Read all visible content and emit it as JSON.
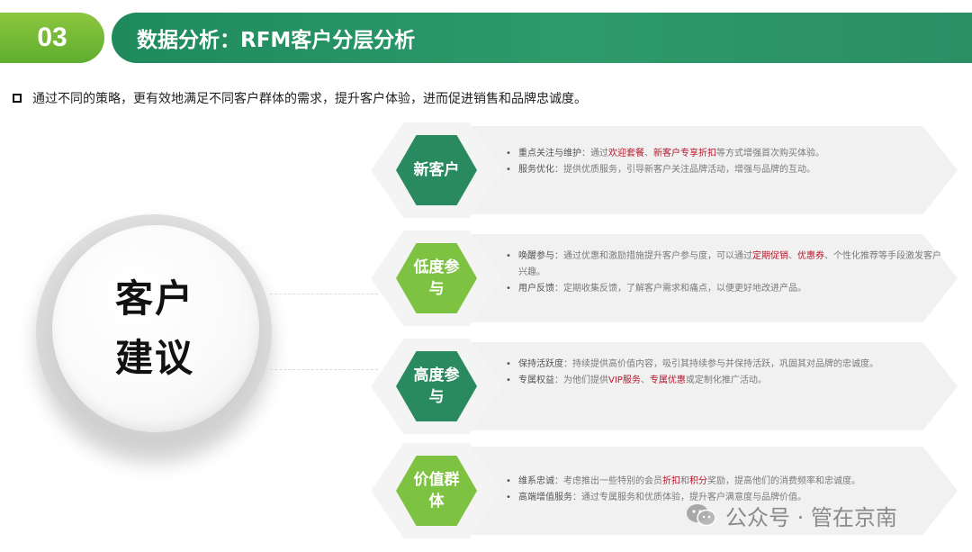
{
  "header": {
    "number": "03",
    "title": "数据分析：RFM客户分层分析"
  },
  "intro": "通过不同的策略，更有效地满足不同客户群体的需求，提升客户体验，进而促进销售和品牌忠诚度。",
  "center": {
    "line1": "客户",
    "line2": "建议"
  },
  "rows": [
    {
      "badge": "新客户",
      "badge_color": "#2a8a5f",
      "bullets": [
        {
          "label": "重点关注与维护",
          "pre": "：通过",
          "hl1": "欢迎套餐",
          "mid": "、",
          "hl2": "新客户专享折扣",
          "post": "等方式增强首次购买体验。"
        },
        {
          "label": "服务优化",
          "pre": "：提供优质服务，引导新客户关注品牌活动，增强与品牌的互动。",
          "hl1": "",
          "mid": "",
          "hl2": "",
          "post": ""
        }
      ]
    },
    {
      "badge": "低度参与",
      "badge_color": "#7ec242",
      "bullets": [
        {
          "label": "唤醒参与",
          "pre": "：通过优惠和激励措施提升客户参与度，可以通过",
          "hl1": "定期促销",
          "mid": "、",
          "hl2": "优惠券",
          "post": "、个性化推荐等手段激发客户兴趣。"
        },
        {
          "label": "用户反馈",
          "pre": "：定期收集反馈，了解客户需求和痛点，以便更好地改进产品。",
          "hl1": "",
          "mid": "",
          "hl2": "",
          "post": ""
        }
      ]
    },
    {
      "badge": "高度参与",
      "badge_color": "#2a8a5f",
      "bullets": [
        {
          "label": "保持活跃度",
          "pre": "：持续提供高价值内容，吸引其持续参与并保持活跃，巩固其对品牌的忠诚度。",
          "hl1": "",
          "mid": "",
          "hl2": "",
          "post": ""
        },
        {
          "label": "专属权益",
          "pre": "：为他们提供",
          "hl1": "VIP服务",
          "mid": "、",
          "hl2": "专属优惠",
          "post": "或定制化推广活动。"
        }
      ]
    },
    {
      "badge": "价值群体",
      "badge_color": "#7ec242",
      "bullets": [
        {
          "label": "维系忠诚",
          "pre": "：考虑推出一些特别的会员",
          "hl1": "折扣",
          "mid": "和",
          "hl2": "积分",
          "post": "奖励，提高他们的消费频率和忠诚度。"
        },
        {
          "label": "高端增值服务",
          "pre": "：通过专属服务和优质体验，提升客户满意度与品牌价值。",
          "hl1": "",
          "mid": "",
          "hl2": "",
          "post": ""
        }
      ]
    }
  ],
  "watermark": {
    "text": "公众号 · 管在京南",
    "icon": "wechat-icon"
  }
}
